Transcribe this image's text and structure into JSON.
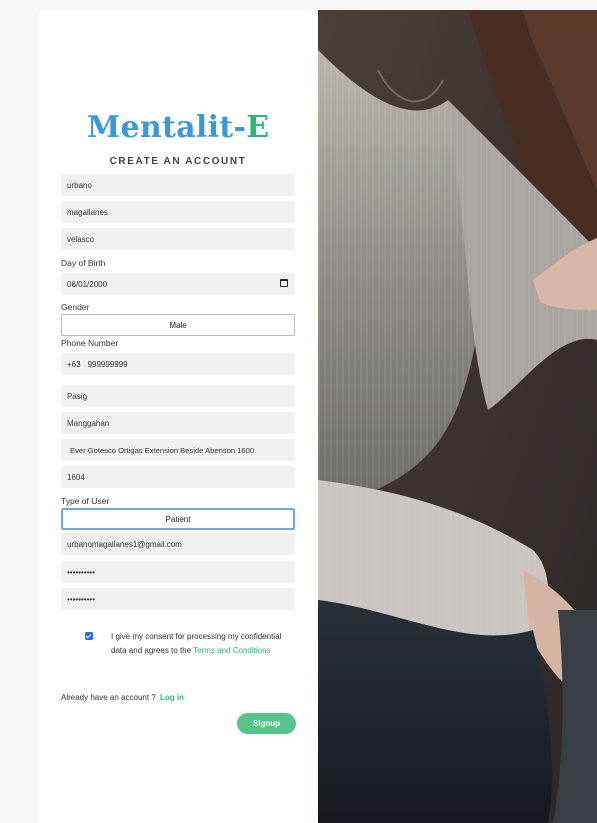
{
  "brand": {
    "part1": "Mentalit-",
    "part2": "E"
  },
  "form": {
    "title": "CREATE AN ACCOUNT",
    "first_name": "urbano",
    "middle_name": "magallanes",
    "last_name": "velasco",
    "dob_label": "Day of Birth",
    "dob_value": "06/01/2000",
    "gender_label": "Gender",
    "gender_value": "Male",
    "phone_label": "Phone Number",
    "phone_prefix": "+63",
    "phone_value": "999999999",
    "city": "Pasig",
    "barangay": "Manggahan",
    "street": "Ever Gotesco Ortigas Extension Beside Abenson 1600",
    "zip": "1604",
    "user_type_label": "Type of User",
    "user_type_value": "Patient",
    "email": "urbanomagallanes1@gmail.com",
    "password": "••••••••••",
    "confirm_password": "••••••••••",
    "consent_text": "I give my consent for processing my confidential data and agrees to the ",
    "consent_link": "Terms and Conditions",
    "consent_checked": true,
    "login_prompt": "Already have an account ? ",
    "login_link": "Log in",
    "signup_label": "Signup"
  },
  "colors": {
    "brand_blue": "#3a9ad9",
    "brand_green": "#2fb57a",
    "signup_button": "#56c48b",
    "focus_border": "#6fa8e6"
  }
}
